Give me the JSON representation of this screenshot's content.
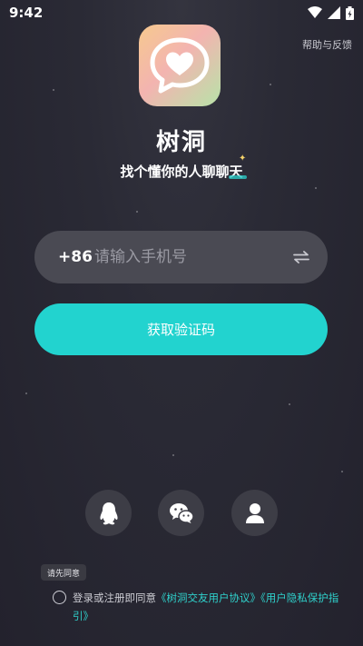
{
  "status_bar": {
    "time": "9:42",
    "icons": [
      "wifi-icon",
      "signal-icon",
      "battery-charging-icon"
    ]
  },
  "header": {
    "help_label": "帮助与反馈"
  },
  "brand": {
    "logo_icon": "heart-chat-bubble-icon",
    "app_name": "树洞",
    "slogan": "找个懂你的人聊聊天"
  },
  "login_form": {
    "country_code": "+86",
    "phone_placeholder": "请输入手机号",
    "phone_value": "",
    "switch_icon": "swap-arrows-icon",
    "get_code_label": "获取验证码"
  },
  "social_login": [
    {
      "icon": "qq-icon"
    },
    {
      "icon": "wechat-icon"
    },
    {
      "icon": "person-icon"
    }
  ],
  "agreement": {
    "tooltip": "请先同意",
    "prefix": "登录或注册即同意",
    "user_agreement": "《树洞交友用户协议》",
    "privacy_policy": "《用户隐私保护指引》",
    "checked": false
  },
  "colors": {
    "background": "#25242f",
    "accent": "#22d3cf",
    "field": "#4a4a53"
  }
}
